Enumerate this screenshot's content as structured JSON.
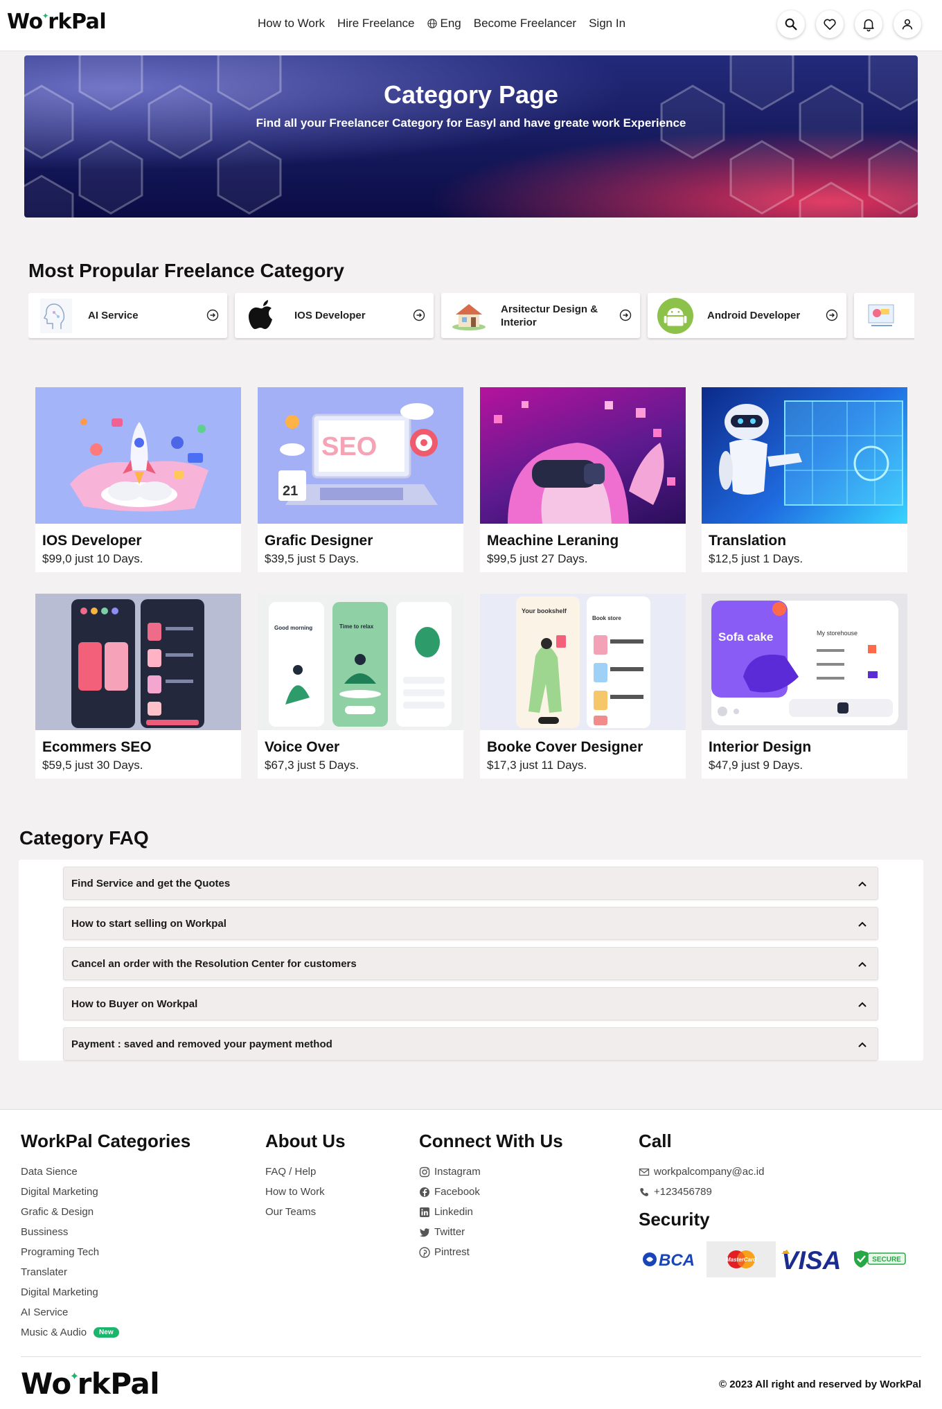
{
  "header": {
    "logo": {
      "before": "Wo",
      "spark": "✦",
      "after": "rkPal"
    },
    "nav": [
      "How to Work",
      "Hire Freelance",
      "Eng",
      "Become Freelancer",
      "Sign In"
    ]
  },
  "hero": {
    "title": "Category Page",
    "subtitle": "Find all your Freelancer Category for Easyl and have greate work Experience"
  },
  "popular": {
    "title": "Most Propular Freelance Category",
    "items": [
      {
        "label": "AI Service",
        "icon": "ai-head-icon"
      },
      {
        "label": "IOS Developer",
        "icon": "apple-icon"
      },
      {
        "label": "Arsitectur Design & Interior",
        "icon": "house-icon"
      },
      {
        "label": "Android Developer",
        "icon": "android-icon"
      },
      {
        "label": "",
        "icon": "design-tools-icon"
      }
    ]
  },
  "services": [
    {
      "title": "IOS Developer",
      "price": "$99,0 just 10 Days."
    },
    {
      "title": "Grafic Designer",
      "price": "$39,5 just 5 Days."
    },
    {
      "title": "Meachine Leraning",
      "price": "$99,5 just 27 Days."
    },
    {
      "title": "Translation",
      "price": "$12,5 just 1 Days."
    },
    {
      "title": "Ecommers SEO",
      "price": "$59,5 just 30 Days."
    },
    {
      "title": "Voice Over",
      "price": "$67,3 just 5 Days."
    },
    {
      "title": "Booke Cover Designer",
      "price": "$17,3 just 11 Days."
    },
    {
      "title": "Interior Design",
      "price": "$47,9 just 9 Days."
    }
  ],
  "service_images": {
    "seo_word": "SEO",
    "calendar_day": "21",
    "app_good_morning": "Good morning",
    "app_time_to_relax": "Time to relax",
    "app_bookshelf": "Your bookshelf",
    "app_book_store": "Book store",
    "app_sofa": "Sofa cake",
    "app_storehouse": "My storehouse"
  },
  "faq": {
    "title": "Category FAQ",
    "items": [
      "Find Service and get the Quotes",
      "How to start selling on Workpal",
      "Cancel an order with the Resolution Center for customers",
      "How to Buyer on Workpal",
      "Payment : saved and removed your payment method"
    ]
  },
  "footer": {
    "categories": {
      "title": "WorkPal Categories",
      "items": [
        "Data Sience",
        "Digital Marketing",
        "Grafic & Design",
        "Bussiness",
        "Programing Tech",
        "Translater",
        "Digital Marketing",
        "AI Service",
        "Music & Audio"
      ],
      "new_badge": "New"
    },
    "about": {
      "title": "About Us",
      "items": [
        "FAQ / Help",
        "How to Work",
        "Our Teams"
      ]
    },
    "connect": {
      "title": "Connect With Us",
      "items": [
        "Instagram",
        "Facebook",
        "Linkedin",
        "Twitter",
        "Pintrest"
      ]
    },
    "call": {
      "title": "Call",
      "email": "workpalcompany@ac.id",
      "phone": "+123456789"
    },
    "security": {
      "title": "Security",
      "logos": [
        "BCA",
        "MasterCard",
        "VISA",
        "SECURE"
      ]
    },
    "copyright": "© 2023 All right and reserved by WorkPal"
  }
}
